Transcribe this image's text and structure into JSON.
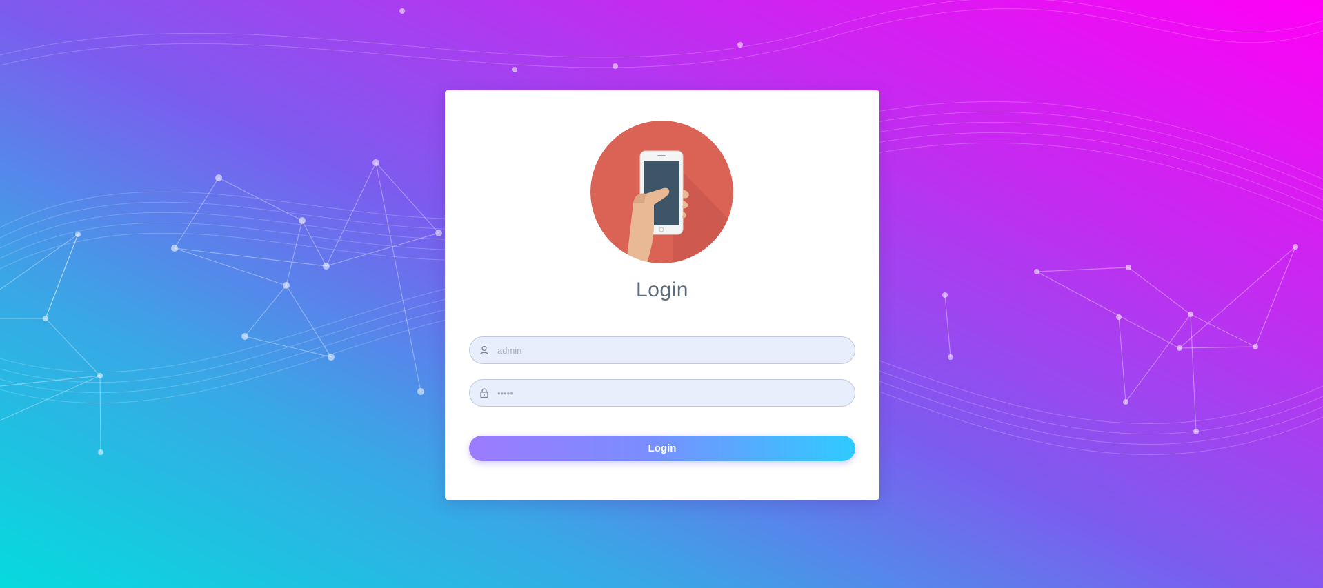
{
  "login": {
    "title": "Login",
    "username": {
      "placeholder": "admin",
      "icon": "user-icon"
    },
    "password": {
      "placeholder": "•••••",
      "icon": "lock-icon"
    },
    "button_label": "Login"
  },
  "colors": {
    "accent_start": "#9c7bff",
    "accent_end": "#2fcbff",
    "avatar_bg": "#db6356",
    "input_bg": "#e8eefb"
  }
}
